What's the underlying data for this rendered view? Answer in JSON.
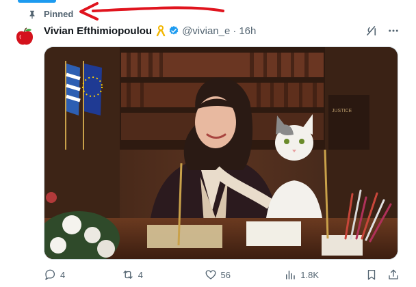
{
  "pinned": {
    "label": "Pinned"
  },
  "author": {
    "name": "Vivian Efthimiopoulou",
    "handle": "@vivian_e",
    "separator": "·",
    "time": "16h",
    "avatar_icon": "apple-icon",
    "badges": [
      "yellow-ribbon-icon",
      "verified-icon"
    ]
  },
  "media": {
    "library_label": "JUSTICE",
    "description_icon": "photo"
  },
  "actions": {
    "reply_count": "4",
    "retweet_count": "4",
    "like_count": "56",
    "views_count": "1.8K"
  },
  "colors": {
    "accent": "#1d9bf0",
    "text_secondary": "#536471",
    "annotation_arrow": "#e0141e"
  }
}
